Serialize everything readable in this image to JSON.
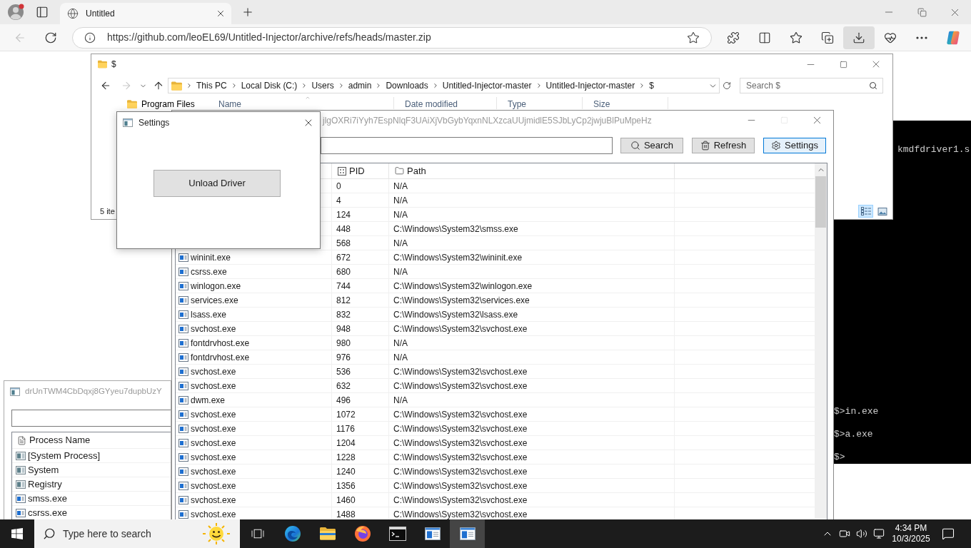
{
  "browser": {
    "tabs": [
      {
        "title": "Untitled",
        "selected": true
      }
    ],
    "nav": [
      {
        "kind": "back",
        "disabled": true
      },
      {
        "kind": "refresh",
        "disabled": false
      }
    ],
    "url": "https://github.com/leoEL69/Untitled-Injector/archive/refs/heads/master.zip",
    "toolbar": [
      {
        "kind": "extensions",
        "selected": false
      },
      {
        "kind": "split",
        "selected": false
      },
      {
        "kind": "favorites",
        "selected": false
      },
      {
        "kind": "collections",
        "selected": false
      },
      {
        "kind": "downloads",
        "selected": true
      },
      {
        "kind": "essentials",
        "selected": false
      },
      {
        "kind": "more",
        "selected": false
      },
      {
        "kind": "copilot",
        "selected": false
      }
    ]
  },
  "explorer": {
    "title": "$",
    "nav": [
      {
        "kind": "back",
        "disabled": false
      },
      {
        "kind": "forward",
        "disabled": true
      },
      {
        "kind": "recent",
        "disabled": false
      },
      {
        "kind": "up",
        "disabled": false
      }
    ],
    "breadcrumbs": [
      "This PC",
      "Local Disk (C:)",
      "Users",
      "admin",
      "Downloads",
      "Untitled-Injector-master",
      "Untitled-Injector-master",
      "$"
    ],
    "search": {
      "placeholder": "Search $"
    },
    "nav_pane": [
      "Program Files"
    ],
    "columns": [
      "Name",
      "Date modified",
      "Type",
      "Size"
    ],
    "status": "5 ite",
    "views": [
      {
        "kind": "details",
        "selected": true
      },
      {
        "kind": "thumbnails",
        "selected": false
      }
    ]
  },
  "console": {
    "output": [
      "kmdfdriver1.s"
    ],
    "prompt_lines": [
      "$>in.exe",
      "$>a.exe",
      "$>"
    ]
  },
  "injector": {
    "title": "jlgOXRi7iYyh7EspNlqF3UAiXjVbGybYqxnNLXzcaUUjmidlE5SJbLyCp2jwjuBlPuMpeHz",
    "controls": [
      {
        "kind": "minimize",
        "disabled": false
      },
      {
        "kind": "maximize",
        "disabled": true
      },
      {
        "kind": "close",
        "disabled": false
      }
    ],
    "buttons": [
      {
        "kind": "search",
        "label": "Search",
        "selected": false
      },
      {
        "kind": "refresh",
        "label": "Refresh",
        "selected": false
      },
      {
        "kind": "settings",
        "label": "Settings",
        "selected": true
      }
    ],
    "columns": [
      {
        "kind": "pid",
        "label": "PID"
      },
      {
        "kind": "path",
        "label": "Path"
      }
    ],
    "rows": [
      {
        "pid": "0",
        "path": "N/A"
      },
      {
        "pid": "4",
        "path": "N/A"
      },
      {
        "pid": "124",
        "path": "N/A"
      },
      {
        "pid": "448",
        "path": "C:\\Windows\\System32\\smss.exe"
      },
      {
        "pid": "568",
        "path": "N/A"
      },
      {
        "name": "wininit.exe",
        "pid": "672",
        "path": "C:\\Windows\\System32\\wininit.exe"
      },
      {
        "name": "csrss.exe",
        "pid": "680",
        "path": "N/A"
      },
      {
        "name": "winlogon.exe",
        "pid": "744",
        "path": "C:\\Windows\\System32\\winlogon.exe"
      },
      {
        "name": "services.exe",
        "pid": "812",
        "path": "C:\\Windows\\System32\\services.exe"
      },
      {
        "name": "lsass.exe",
        "pid": "832",
        "path": "C:\\Windows\\System32\\lsass.exe"
      },
      {
        "name": "svchost.exe",
        "pid": "948",
        "path": "C:\\Windows\\System32\\svchost.exe"
      },
      {
        "name": "fontdrvhost.exe",
        "pid": "980",
        "path": "N/A"
      },
      {
        "name": "fontdrvhost.exe",
        "pid": "976",
        "path": "N/A"
      },
      {
        "name": "svchost.exe",
        "pid": "536",
        "path": "C:\\Windows\\System32\\svchost.exe"
      },
      {
        "name": "svchost.exe",
        "pid": "632",
        "path": "C:\\Windows\\System32\\svchost.exe"
      },
      {
        "name": "dwm.exe",
        "pid": "496",
        "path": "N/A"
      },
      {
        "name": "svchost.exe",
        "pid": "1072",
        "path": "C:\\Windows\\System32\\svchost.exe"
      },
      {
        "name": "svchost.exe",
        "pid": "1176",
        "path": "C:\\Windows\\System32\\svchost.exe"
      },
      {
        "name": "svchost.exe",
        "pid": "1204",
        "path": "C:\\Windows\\System32\\svchost.exe"
      },
      {
        "name": "svchost.exe",
        "pid": "1228",
        "path": "C:\\Windows\\System32\\svchost.exe"
      },
      {
        "name": "svchost.exe",
        "pid": "1240",
        "path": "C:\\Windows\\System32\\svchost.exe"
      },
      {
        "name": "svchost.exe",
        "pid": "1356",
        "path": "C:\\Windows\\System32\\svchost.exe"
      },
      {
        "name": "svchost.exe",
        "pid": "1460",
        "path": "C:\\Windows\\System32\\svchost.exe"
      },
      {
        "name": "svchost.exe",
        "pid": "1488",
        "path": "C:\\Windows\\System32\\svchost.exe"
      }
    ]
  },
  "settings_dialog": {
    "title": "Settings",
    "button": "Unload Driver"
  },
  "second_window": {
    "title": "drUnTWM4CbDqxj8GYyeu7dupbUzY",
    "column": "Process Name",
    "rows": [
      {
        "name": "[System Process]",
        "kind": "plain"
      },
      {
        "name": "System",
        "kind": "plain"
      },
      {
        "name": "Registry",
        "kind": "plain"
      },
      {
        "name": "smss.exe",
        "kind": "exe"
      },
      {
        "name": "csrss.exe",
        "kind": "exe"
      }
    ]
  },
  "taskbar": {
    "search": {
      "placeholder": "Type here to search"
    },
    "apps": [
      {
        "kind": "task_view",
        "selected": false
      },
      {
        "kind": "edge",
        "selected": false
      },
      {
        "kind": "explorer",
        "selected": false
      },
      {
        "kind": "firefox",
        "selected": false
      },
      {
        "kind": "terminal",
        "selected": false
      },
      {
        "kind": "app",
        "selected": false
      },
      {
        "kind": "app",
        "selected": true
      }
    ],
    "tray": [
      {
        "kind": "chevron"
      },
      {
        "kind": "camera"
      },
      {
        "kind": "volume"
      },
      {
        "kind": "network"
      }
    ],
    "clock": {
      "time": "4:34 PM",
      "date": "10/3/2025"
    }
  }
}
